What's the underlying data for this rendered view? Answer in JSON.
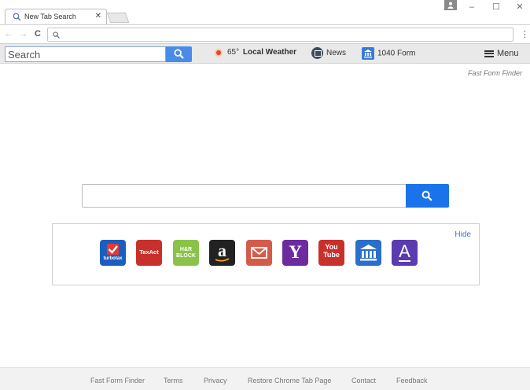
{
  "browser": {
    "tab_title": "New Tab Search",
    "tab_close": "✕",
    "omnibox_value": "",
    "window_controls": {
      "minimize": "–",
      "maximize": "☐",
      "close": "✕"
    },
    "nav": {
      "back": "←",
      "forward": "→",
      "reload": "C",
      "menu": "⋮"
    }
  },
  "toolbar": {
    "search_placeholder": "Search",
    "weather_temp": "65°",
    "weather_label": "Local Weather",
    "news_label": "News",
    "form_label": "1040 Form",
    "menu_label": "Menu"
  },
  "page": {
    "brand_link": "Fast Form Finder",
    "search_value": "",
    "hide_label": "Hide"
  },
  "shortcuts": [
    {
      "name": "turbotax",
      "label": "turbotax",
      "color": "#1b5ebf"
    },
    {
      "name": "taxact",
      "label": "TaxAct",
      "color": "#c8302c"
    },
    {
      "name": "hr-block",
      "label": "H&R BLOCK",
      "color": "#8bc24a"
    },
    {
      "name": "amazon",
      "label": "a",
      "color": "#222222"
    },
    {
      "name": "mail",
      "label": "",
      "color": "#d65a4a"
    },
    {
      "name": "yahoo",
      "label": "Y",
      "color": "#6d2ba0"
    },
    {
      "name": "youtube",
      "label": "You Tube",
      "color": "#c8302c"
    },
    {
      "name": "bank",
      "label": "",
      "color": "#2a6fc9"
    },
    {
      "name": "form-a",
      "label": "A",
      "color": "#5b3bb0"
    }
  ],
  "footer": {
    "links": [
      "Fast Form Finder",
      "Terms",
      "Privacy",
      "Restore Chrome Tab Page",
      "Contact",
      "Feedback"
    ]
  },
  "colors": {
    "accent": "#1a73e8",
    "toolbar_button": "#4a8be8",
    "link": "#3a78c3"
  }
}
